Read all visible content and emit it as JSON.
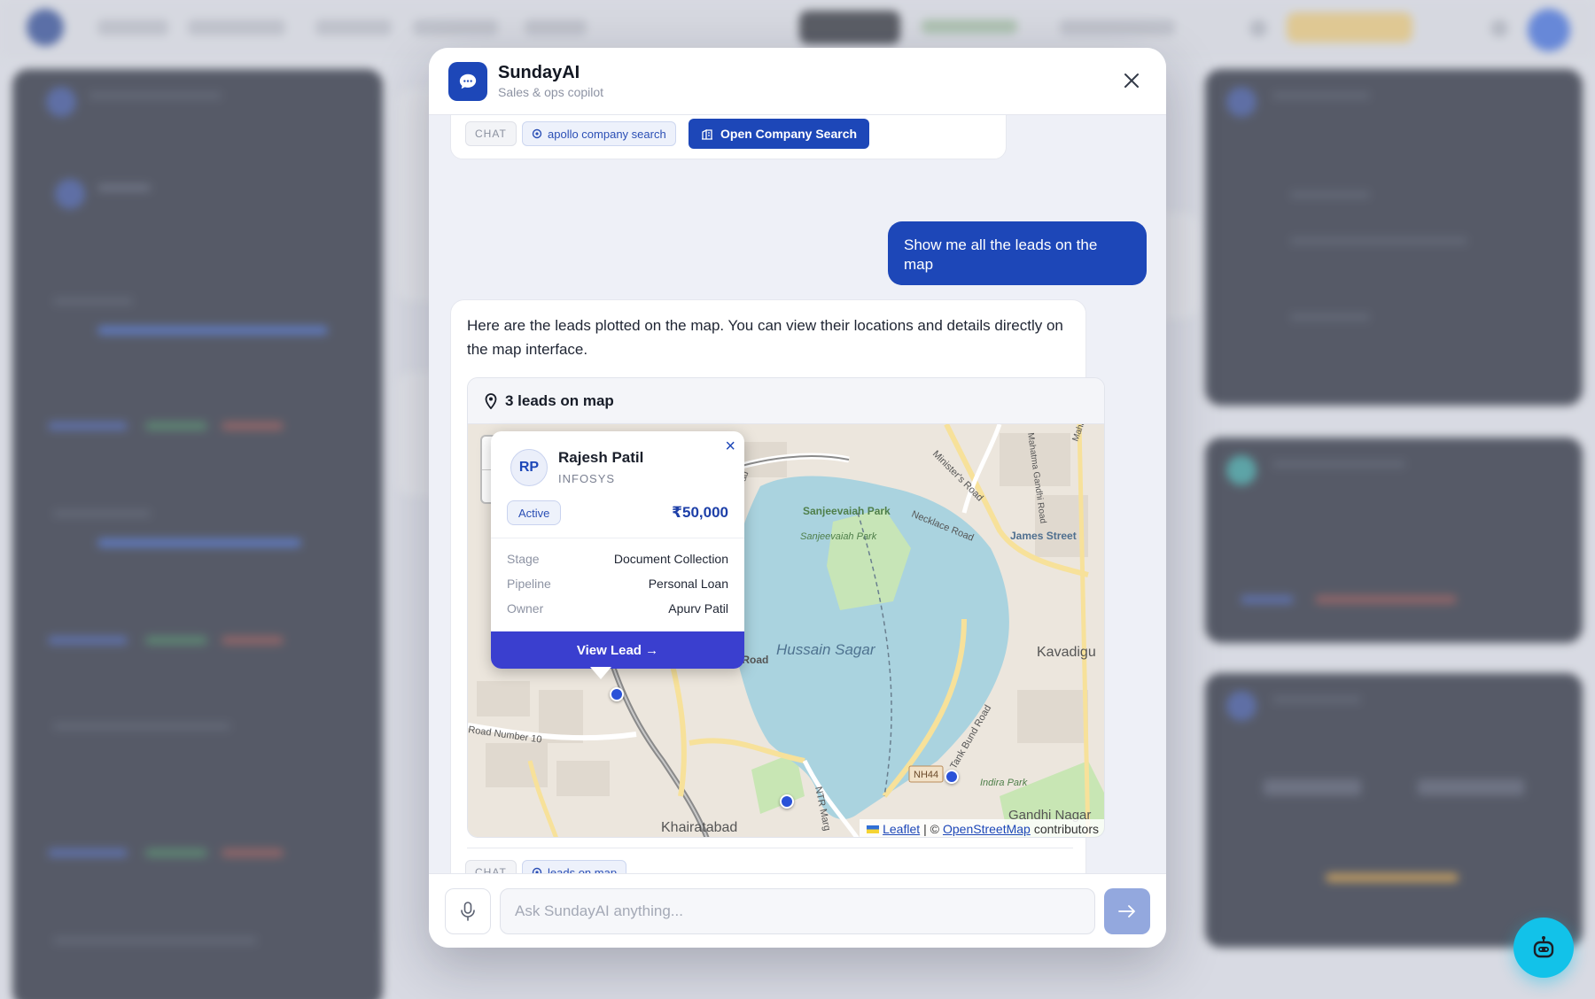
{
  "assistant": {
    "name": "SundayAI",
    "subtitle": "Sales & ops copilot"
  },
  "previous_message": {
    "tag": "CHAT",
    "tool": "apollo company search",
    "action_label": "Open Company Search"
  },
  "user_message": "Show me all the leads on the map",
  "ai_message": {
    "text": "Here are the leads plotted on the map. You can view their locations and details directly on the map interface.",
    "map_title": "3 leads on map",
    "tag": "CHAT",
    "tool": "leads on map"
  },
  "map": {
    "zoom_in": "+",
    "zoom_out": "−",
    "attribution": {
      "leaflet": "Leaflet",
      "separator": "| ©",
      "osm": "OpenStreetMap",
      "suffix": "contributors"
    },
    "labels": {
      "lake": "Hussain Sagar",
      "park": "Sanjeevaiah Park",
      "park2": "Sanjeevaiah Park",
      "area1": "Kavadigu",
      "area2": "Khairatabad",
      "area3": "Gandhi Nagar",
      "road1": "Necklace Road",
      "road2": "Necklace Road",
      "road3": "Tank Bund Road",
      "road4": "Road Number 10",
      "road5": "NTR Marg",
      "road6": "Minister's Road",
      "road7": "James Street",
      "road8": "Mahatma Gandhi Road",
      "road9": "Mahankali Street",
      "highway": "NH44",
      "road10": "Lake Road",
      "road11": "Indira Park"
    }
  },
  "lead_popup": {
    "close": "×",
    "initials": "RP",
    "name": "Rajesh Patil",
    "company": "INFOSYS",
    "status": "Active",
    "amount": "₹50,000",
    "rows": [
      {
        "label": "Stage",
        "value": "Document Collection"
      },
      {
        "label": "Pipeline",
        "value": "Personal Loan"
      },
      {
        "label": "Owner",
        "value": "Apurv Patil"
      }
    ],
    "cta": "View Lead →"
  },
  "input": {
    "placeholder": "Ask SundayAI anything..."
  },
  "colors": {
    "primary": "#1d47b8",
    "popup_button": "#3a3fcf",
    "fab": "#12c2e9",
    "water": "#aad3df"
  }
}
